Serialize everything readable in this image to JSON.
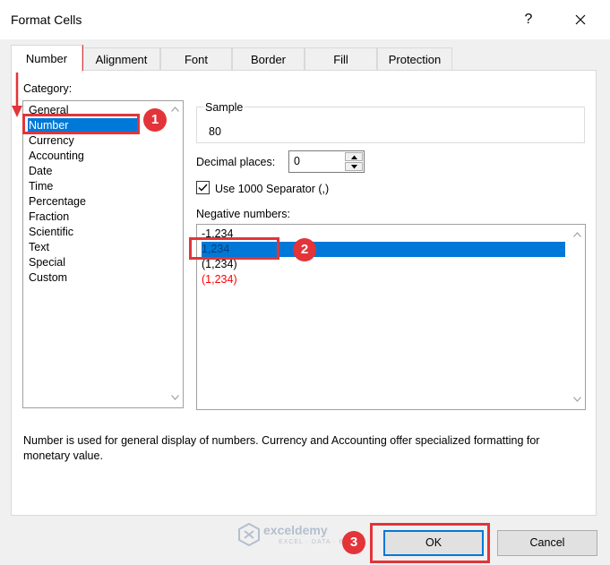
{
  "window": {
    "title": "Format Cells",
    "help": "?"
  },
  "tabs": [
    "Number",
    "Alignment",
    "Font",
    "Border",
    "Fill",
    "Protection"
  ],
  "category": {
    "label": "Category:",
    "items": [
      "General",
      "Number",
      "Currency",
      "Accounting",
      "Date",
      "Time",
      "Percentage",
      "Fraction",
      "Scientific",
      "Text",
      "Special",
      "Custom"
    ],
    "selected": "Number"
  },
  "sample": {
    "label": "Sample",
    "value": "80"
  },
  "decimal": {
    "label": "Decimal places:",
    "value": "0"
  },
  "separator": {
    "label": "Use 1000 Separator (,)",
    "checked": true
  },
  "negative": {
    "label": "Negative numbers:",
    "items": [
      "-1,234",
      "1,234",
      "(1,234)",
      "(1,234)"
    ],
    "red_color": "#ff0000"
  },
  "description": "Number is used for general display of numbers.  Currency and Accounting offer specialized formatting for monetary value.",
  "buttons": {
    "ok": "OK",
    "cancel": "Cancel"
  },
  "watermark": {
    "name": "exceldemy",
    "tagline": "EXCEL · DATA · BI"
  },
  "annotations": {
    "step1": "1",
    "step2": "2",
    "step3": "3",
    "color": "#e3343a"
  },
  "colors": {
    "accent": "#0078d7"
  }
}
